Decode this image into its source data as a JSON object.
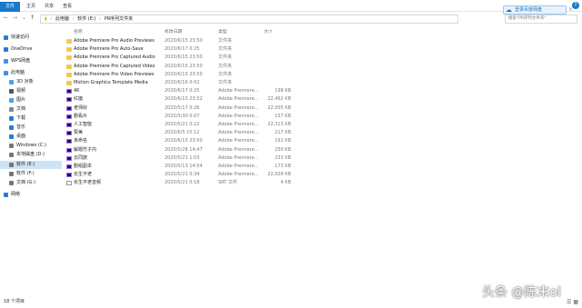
{
  "ribbon": {
    "file": "文件",
    "tabs": [
      "主页",
      "共享",
      "查看"
    ]
  },
  "address": {
    "back": "←",
    "forward": "→",
    "up": "↑",
    "crumbs": [
      "此电脑",
      "软件 (E:)",
      "PR序列文件夹"
    ],
    "search_placeholder": "搜索\"PR序列文件夹\"",
    "cloud_badge": "登录百度网盘"
  },
  "sidebar": {
    "items": [
      {
        "label": "快速访问",
        "icon": "star-icon",
        "color": "#2a7ad5"
      },
      {
        "label": "OneDrive",
        "icon": "cloud-icon",
        "color": "#2a7ad5"
      },
      {
        "label": "WPS网盘",
        "icon": "cloud-icon",
        "color": "#4a90e2"
      },
      {
        "label": "此电脑",
        "icon": "computer-icon",
        "color": "#4a90e2"
      },
      {
        "label": "3D 对象",
        "icon": "cube-icon",
        "color": "#4aa3df"
      },
      {
        "label": "视频",
        "icon": "video-icon",
        "color": "#555555"
      },
      {
        "label": "图片",
        "icon": "picture-icon",
        "color": "#4aa3df"
      },
      {
        "label": "文档",
        "icon": "document-icon",
        "color": "#888888"
      },
      {
        "label": "下载",
        "icon": "download-icon",
        "color": "#2a7ad5"
      },
      {
        "label": "音乐",
        "icon": "music-icon",
        "color": "#2a7ad5"
      },
      {
        "label": "桌面",
        "icon": "desktop-icon",
        "color": "#2a7ad5"
      },
      {
        "label": "Windows (C:)",
        "icon": "drive-icon",
        "color": "#777777"
      },
      {
        "label": "本地磁盘 (D:)",
        "icon": "drive-icon",
        "color": "#777777"
      },
      {
        "label": "软件 (E:)",
        "icon": "drive-icon",
        "color": "#777777"
      },
      {
        "label": "软件 (F:)",
        "icon": "drive-icon",
        "color": "#777777"
      },
      {
        "label": "文档 (G:)",
        "icon": "drive-icon",
        "color": "#777777"
      },
      {
        "label": "网络",
        "icon": "network-icon",
        "color": "#2a7ad5"
      }
    ]
  },
  "columns": {
    "name": "名称",
    "date": "修改日期",
    "type": "类型",
    "size": "大小"
  },
  "files": [
    {
      "kind": "folder",
      "name": "Adobe Premiere Pro Audio Previews",
      "date": "2020/6/15 23:50",
      "type": "文件夹",
      "size": ""
    },
    {
      "kind": "folder",
      "name": "Adobe Premiere Pro Auto-Save",
      "date": "2020/6/17 0:25",
      "type": "文件夹",
      "size": ""
    },
    {
      "kind": "folder",
      "name": "Adobe Premiere Pro Captured Audio",
      "date": "2020/6/15 23:50",
      "type": "文件夹",
      "size": ""
    },
    {
      "kind": "folder",
      "name": "Adobe Premiere Pro Captured Video",
      "date": "2020/6/15 23:50",
      "type": "文件夹",
      "size": ""
    },
    {
      "kind": "folder",
      "name": "Adobe Premiere Pro Video Previews",
      "date": "2020/6/15 23:50",
      "type": "文件夹",
      "size": ""
    },
    {
      "kind": "folder",
      "name": "Motion Graphics Template Media",
      "date": "2020/6/16 0:02",
      "type": "文件夹",
      "size": ""
    },
    {
      "kind": "pr",
      "name": "4K",
      "date": "2020/6/17 0:25",
      "type": "Adobe Premiere...",
      "size": "198 KB"
    },
    {
      "kind": "pr",
      "name": "红旗",
      "date": "2020/6/15 23:52",
      "type": "Adobe Premiere...",
      "size": "22,462 KB"
    },
    {
      "kind": "pr",
      "name": "老师好",
      "date": "2020/5/17 0:26",
      "type": "Adobe Premiere...",
      "size": "22,005 KB"
    },
    {
      "kind": "pr",
      "name": "剧看片",
      "date": "2020/5/30 0:07",
      "type": "Adobe Premiere...",
      "size": "157 KB"
    },
    {
      "kind": "pr",
      "name": "人工智能",
      "date": "2020/5/21 0:22",
      "type": "Adobe Premiere...",
      "size": "22,313 KB"
    },
    {
      "kind": "pr",
      "name": "赞美",
      "date": "2020/6/5 15:12",
      "type": "Adobe Premiere...",
      "size": "217 KB"
    },
    {
      "kind": "pr",
      "name": "未命名",
      "date": "2020/6/15 23:50",
      "type": "Adobe Premiere...",
      "size": "161 KB"
    },
    {
      "kind": "pr",
      "name": "解题竹子内",
      "date": "2020/5/28 14:47",
      "type": "Adobe Premiere...",
      "size": "250 KB"
    },
    {
      "kind": "pr",
      "name": "云同旅",
      "date": "2020/5/21 1:03",
      "type": "Adobe Premiere...",
      "size": "233 KB"
    },
    {
      "kind": "pr",
      "name": "剧组副本",
      "date": "2020/5/13 14:54",
      "type": "Adobe Premiere...",
      "size": "173 KB"
    },
    {
      "kind": "pr",
      "name": "长生不老",
      "date": "2020/5/21 0:34",
      "type": "Adobe Premiere...",
      "size": "22,509 KB"
    },
    {
      "kind": "srt",
      "name": "长生不老音频",
      "date": "2020/5/21 0:18",
      "type": "SRT 文件",
      "size": "4 KB"
    }
  ],
  "status": {
    "count": "18 个项目"
  },
  "watermark": "头条 @陈末ol"
}
